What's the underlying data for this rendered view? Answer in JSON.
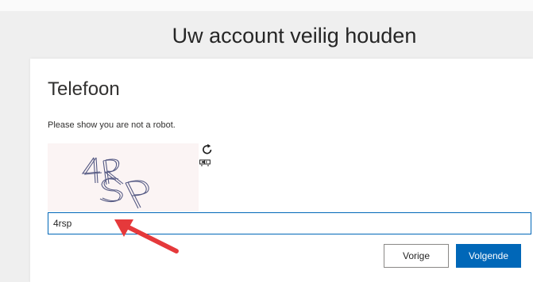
{
  "header": {
    "title": "Uw account veilig houden"
  },
  "card": {
    "title": "Telefoon",
    "instruction": "Please show you are not a robot."
  },
  "captcha": {
    "image_text": "4RSP",
    "refresh_icon": "refresh-icon",
    "audio_icon": "audio-speaker-icon"
  },
  "input": {
    "value": "4rsp"
  },
  "buttons": {
    "back_label": "Vorige",
    "next_label": "Volgende"
  },
  "colors": {
    "accent": "#0067b8",
    "annotation": "#e5393b"
  }
}
